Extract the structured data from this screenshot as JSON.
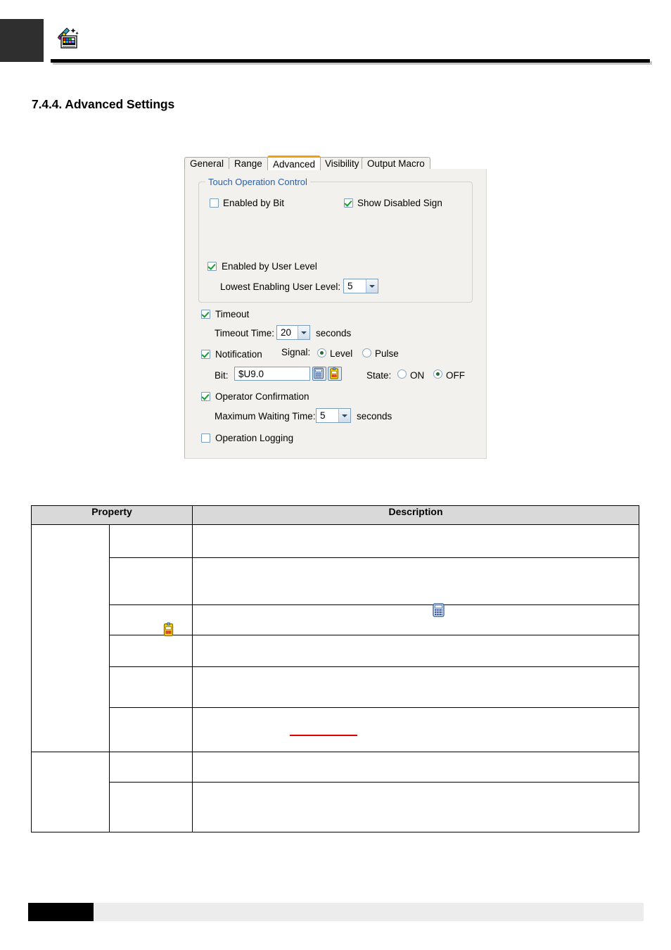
{
  "header": {
    "icon": "panel-wand-icon"
  },
  "section": {
    "title": "7.4.4. Advanced Settings"
  },
  "dialog": {
    "tabs": [
      {
        "label": "General",
        "active": false
      },
      {
        "label": "Range",
        "active": false
      },
      {
        "label": "Advanced",
        "active": true
      },
      {
        "label": "Visibility",
        "active": false
      },
      {
        "label": "Output Macro",
        "active": false
      }
    ],
    "group": {
      "title": "Touch Operation Control",
      "enabled_by_bit": {
        "label": "Enabled by Bit",
        "checked": false
      },
      "show_disabled_sign": {
        "label": "Show Disabled Sign",
        "checked": true
      },
      "enabled_by_user_level": {
        "label": "Enabled by User Level",
        "checked": true
      },
      "lowest_user_level": {
        "label": "Lowest Enabling User Level:",
        "value": "5"
      }
    },
    "timeout": {
      "label": "Timeout",
      "checked": true,
      "time_label": "Timeout Time:",
      "time_value": "20",
      "units": "seconds"
    },
    "notification": {
      "label": "Notification",
      "checked": true,
      "signal_label": "Signal:",
      "signal_level": "Level",
      "signal_pulse": "Pulse",
      "signal_selected": "Level",
      "bit_label": "Bit:",
      "bit_value": "$U9.0",
      "keypad_icon": "calculator-icon",
      "tag_icon": "tag-clipboard-icon",
      "state_label": "State:",
      "state_on": "ON",
      "state_off": "OFF",
      "state_selected": "OFF"
    },
    "operator_confirmation": {
      "label": "Operator Confirmation",
      "checked": true,
      "wait_label": "Maximum Waiting Time:",
      "wait_value": "5",
      "units": "seconds"
    },
    "operation_logging": {
      "label": "Operation Logging",
      "checked": false
    }
  },
  "table": {
    "headers": {
      "property": "Property",
      "description": "Description"
    },
    "rows": [
      {
        "group": "",
        "property": "",
        "description": ""
      },
      {
        "group": "",
        "property": "",
        "description": ""
      },
      {
        "group": "",
        "property": "",
        "description": ""
      },
      {
        "group": "",
        "property": "",
        "description": ""
      },
      {
        "group": "",
        "property": "",
        "description": ""
      },
      {
        "group": "",
        "property": "",
        "description": ""
      },
      {
        "group": "",
        "property": "",
        "description": ""
      },
      {
        "group": "",
        "property": "",
        "description": ""
      }
    ]
  },
  "colors": {
    "tab_accent": "#f0a000",
    "group_title": "#2b5fa8",
    "checkbox_check": "#1a9b33",
    "redline": "#e00000",
    "dialog_bg": "#f2f1ed",
    "table_header_bg": "#d9d9d9"
  }
}
